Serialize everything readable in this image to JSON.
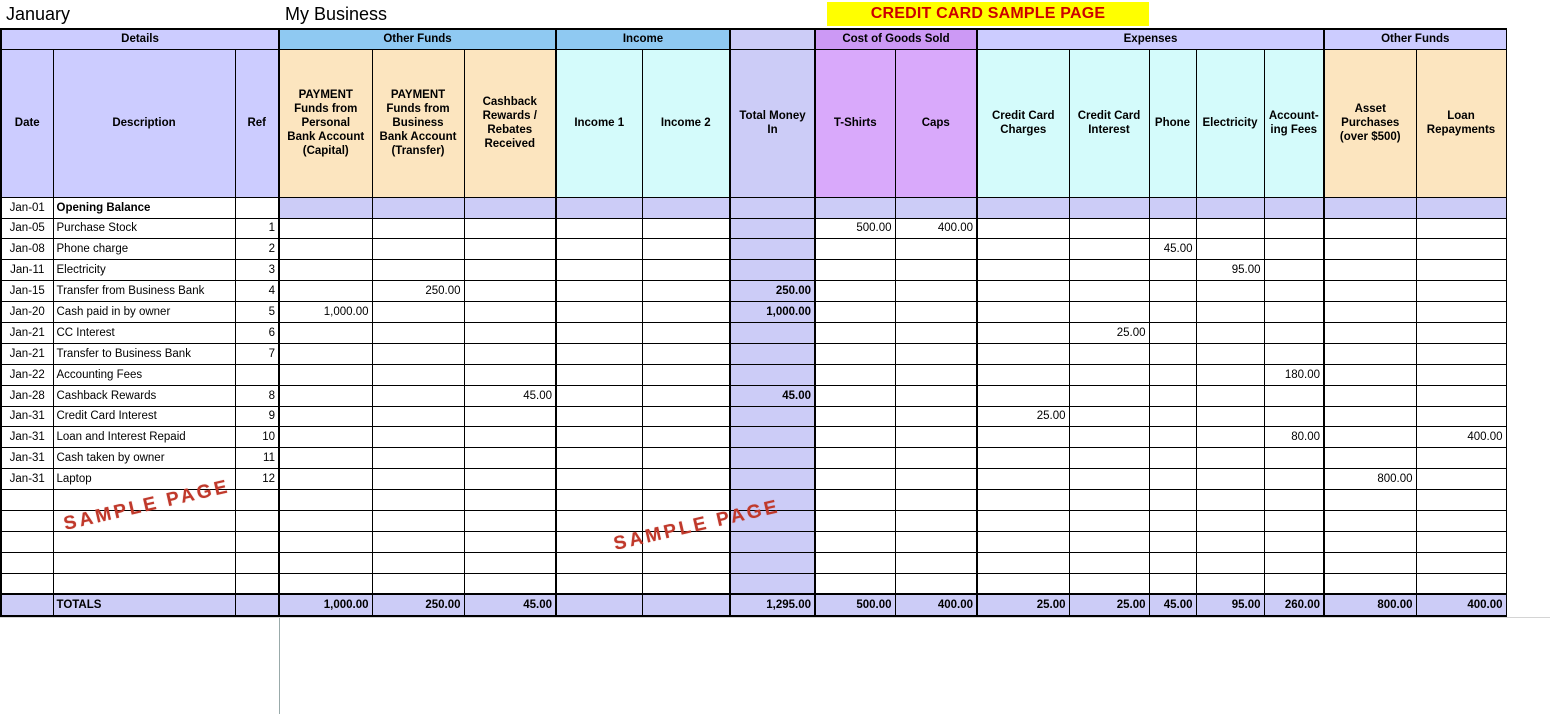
{
  "title": {
    "month": "January",
    "business": "My Business",
    "banner": "CREDIT CARD SAMPLE PAGE"
  },
  "watermark": {
    "text": "SAMPLE PAGE"
  },
  "colors": {
    "details_band": "#CCCCFF",
    "other_funds_band": "#8FC9F2",
    "income_band": "#8FC9F2",
    "cogs_band": "#CC99F5",
    "expenses_band": "#CCCCFF",
    "cream_cell": "#FCE5BF",
    "cyan_cell": "#D4FBFB",
    "lavender_cell": "#CCCCF7",
    "purple_cell": "#D9A9FB",
    "banner_bg": "#FFFF00",
    "banner_text": "#CC0000",
    "watermark_text": "#C0392B"
  },
  "groups": [
    {
      "label": "Details",
      "span": 3
    },
    {
      "label": "Other Funds",
      "span": 3
    },
    {
      "label": "Income",
      "span": 2
    },
    {
      "label": "",
      "span": 1
    },
    {
      "label": "Cost of Goods Sold",
      "span": 2
    },
    {
      "label": "Expenses",
      "span": 5
    },
    {
      "label": "Other Funds",
      "span": 2
    }
  ],
  "columns": [
    {
      "key": "date",
      "label": "Date"
    },
    {
      "key": "description",
      "label": "Description"
    },
    {
      "key": "ref",
      "label": "Ref"
    },
    {
      "key": "pay_personal",
      "label": "PAYMENT\nFunds from\nPersonal\nBank Account\n(Capital)"
    },
    {
      "key": "pay_business",
      "label": "PAYMENT\nFunds from\nBusiness\nBank Account\n(Transfer)"
    },
    {
      "key": "cashback",
      "label": "Cashback\nRewards /\nRebates\nReceived"
    },
    {
      "key": "income1",
      "label": "Income 1"
    },
    {
      "key": "income2",
      "label": "Income 2"
    },
    {
      "key": "total_in",
      "label": "Total Money\nIn"
    },
    {
      "key": "tshirts",
      "label": "T-Shirts"
    },
    {
      "key": "caps",
      "label": "Caps"
    },
    {
      "key": "cc_charges",
      "label": "Credit Card\nCharges"
    },
    {
      "key": "cc_interest",
      "label": "Credit Card\nInterest"
    },
    {
      "key": "phone",
      "label": "Phone"
    },
    {
      "key": "electricity",
      "label": "Electricity"
    },
    {
      "key": "accounting",
      "label": "Account-\ning Fees"
    },
    {
      "key": "assets",
      "label": "Asset\nPurchases\n(over $500)"
    },
    {
      "key": "loan",
      "label": "Loan\nRepayments"
    }
  ],
  "rows": [
    {
      "date": "Jan-01",
      "description": "Opening Balance",
      "ref": "",
      "pay_personal": "",
      "pay_business": "",
      "cashback": "",
      "income1": "",
      "income2": "",
      "total_in": "",
      "tshirts": "",
      "caps": "",
      "cc_charges": "",
      "cc_interest": "",
      "phone": "",
      "electricity": "",
      "accounting": "",
      "assets": "",
      "loan": ""
    },
    {
      "date": "Jan-05",
      "description": "Purchase Stock",
      "ref": "1",
      "pay_personal": "",
      "pay_business": "",
      "cashback": "",
      "income1": "",
      "income2": "",
      "total_in": "",
      "tshirts": "500.00",
      "caps": "400.00",
      "cc_charges": "",
      "cc_interest": "",
      "phone": "",
      "electricity": "",
      "accounting": "",
      "assets": "",
      "loan": ""
    },
    {
      "date": "Jan-08",
      "description": "Phone charge",
      "ref": "2",
      "pay_personal": "",
      "pay_business": "",
      "cashback": "",
      "income1": "",
      "income2": "",
      "total_in": "",
      "tshirts": "",
      "caps": "",
      "cc_charges": "",
      "cc_interest": "",
      "phone": "45.00",
      "electricity": "",
      "accounting": "",
      "assets": "",
      "loan": ""
    },
    {
      "date": "Jan-11",
      "description": "Electricity",
      "ref": "3",
      "pay_personal": "",
      "pay_business": "",
      "cashback": "",
      "income1": "",
      "income2": "",
      "total_in": "",
      "tshirts": "",
      "caps": "",
      "cc_charges": "",
      "cc_interest": "",
      "phone": "",
      "electricity": "95.00",
      "accounting": "",
      "assets": "",
      "loan": ""
    },
    {
      "date": "Jan-15",
      "description": "Transfer from Business Bank",
      "ref": "4",
      "pay_personal": "",
      "pay_business": "250.00",
      "cashback": "",
      "income1": "",
      "income2": "",
      "total_in": "250.00",
      "tshirts": "",
      "caps": "",
      "cc_charges": "",
      "cc_interest": "",
      "phone": "",
      "electricity": "",
      "accounting": "",
      "assets": "",
      "loan": ""
    },
    {
      "date": "Jan-20",
      "description": "Cash paid in by owner",
      "ref": "5",
      "pay_personal": "1,000.00",
      "pay_business": "",
      "cashback": "",
      "income1": "",
      "income2": "",
      "total_in": "1,000.00",
      "tshirts": "",
      "caps": "",
      "cc_charges": "",
      "cc_interest": "",
      "phone": "",
      "electricity": "",
      "accounting": "",
      "assets": "",
      "loan": ""
    },
    {
      "date": "Jan-21",
      "description": "CC Interest",
      "ref": "6",
      "pay_personal": "",
      "pay_business": "",
      "cashback": "",
      "income1": "",
      "income2": "",
      "total_in": "",
      "tshirts": "",
      "caps": "",
      "cc_charges": "",
      "cc_interest": "25.00",
      "phone": "",
      "electricity": "",
      "accounting": "",
      "assets": "",
      "loan": ""
    },
    {
      "date": "Jan-21",
      "description": "Transfer to Business Bank",
      "ref": "7",
      "pay_personal": "",
      "pay_business": "",
      "cashback": "",
      "income1": "",
      "income2": "",
      "total_in": "",
      "tshirts": "",
      "caps": "",
      "cc_charges": "",
      "cc_interest": "",
      "phone": "",
      "electricity": "",
      "accounting": "",
      "assets": "",
      "loan": ""
    },
    {
      "date": "Jan-22",
      "description": "Accounting Fees",
      "ref": "",
      "pay_personal": "",
      "pay_business": "",
      "cashback": "",
      "income1": "",
      "income2": "",
      "total_in": "",
      "tshirts": "",
      "caps": "",
      "cc_charges": "",
      "cc_interest": "",
      "phone": "",
      "electricity": "",
      "accounting": "180.00",
      "assets": "",
      "loan": ""
    },
    {
      "date": "Jan-28",
      "description": "Cashback Rewards",
      "ref": "8",
      "pay_personal": "",
      "pay_business": "",
      "cashback": "45.00",
      "income1": "",
      "income2": "",
      "total_in": "45.00",
      "tshirts": "",
      "caps": "",
      "cc_charges": "",
      "cc_interest": "",
      "phone": "",
      "electricity": "",
      "accounting": "",
      "assets": "",
      "loan": ""
    },
    {
      "date": "Jan-31",
      "description": "Credit Card Interest",
      "ref": "9",
      "pay_personal": "",
      "pay_business": "",
      "cashback": "",
      "income1": "",
      "income2": "",
      "total_in": "",
      "tshirts": "",
      "caps": "",
      "cc_charges": "25.00",
      "cc_interest": "",
      "phone": "",
      "electricity": "",
      "accounting": "",
      "assets": "",
      "loan": ""
    },
    {
      "date": "Jan-31",
      "description": "Loan and Interest Repaid",
      "ref": "10",
      "pay_personal": "",
      "pay_business": "",
      "cashback": "",
      "income1": "",
      "income2": "",
      "total_in": "",
      "tshirts": "",
      "caps": "",
      "cc_charges": "",
      "cc_interest": "",
      "phone": "",
      "electricity": "",
      "accounting": "80.00",
      "assets": "",
      "loan": "400.00"
    },
    {
      "date": "Jan-31",
      "description": "Cash taken by owner",
      "ref": "11",
      "pay_personal": "",
      "pay_business": "",
      "cashback": "",
      "income1": "",
      "income2": "",
      "total_in": "",
      "tshirts": "",
      "caps": "",
      "cc_charges": "",
      "cc_interest": "",
      "phone": "",
      "electricity": "",
      "accounting": "",
      "assets": "",
      "loan": ""
    },
    {
      "date": "Jan-31",
      "description": "Laptop",
      "ref": "12",
      "pay_personal": "",
      "pay_business": "",
      "cashback": "",
      "income1": "",
      "income2": "",
      "total_in": "",
      "tshirts": "",
      "caps": "",
      "cc_charges": "",
      "cc_interest": "",
      "phone": "",
      "electricity": "",
      "accounting": "",
      "assets": "800.00",
      "loan": ""
    },
    {
      "date": "",
      "description": "",
      "ref": "",
      "pay_personal": "",
      "pay_business": "",
      "cashback": "",
      "income1": "",
      "income2": "",
      "total_in": "",
      "tshirts": "",
      "caps": "",
      "cc_charges": "",
      "cc_interest": "",
      "phone": "",
      "electricity": "",
      "accounting": "",
      "assets": "",
      "loan": ""
    },
    {
      "date": "",
      "description": "",
      "ref": "",
      "pay_personal": "",
      "pay_business": "",
      "cashback": "",
      "income1": "",
      "income2": "",
      "total_in": "",
      "tshirts": "",
      "caps": "",
      "cc_charges": "",
      "cc_interest": "",
      "phone": "",
      "electricity": "",
      "accounting": "",
      "assets": "",
      "loan": ""
    },
    {
      "date": "",
      "description": "",
      "ref": "",
      "pay_personal": "",
      "pay_business": "",
      "cashback": "",
      "income1": "",
      "income2": "",
      "total_in": "",
      "tshirts": "",
      "caps": "",
      "cc_charges": "",
      "cc_interest": "",
      "phone": "",
      "electricity": "",
      "accounting": "",
      "assets": "",
      "loan": ""
    },
    {
      "date": "",
      "description": "",
      "ref": "",
      "pay_personal": "",
      "pay_business": "",
      "cashback": "",
      "income1": "",
      "income2": "",
      "total_in": "",
      "tshirts": "",
      "caps": "",
      "cc_charges": "",
      "cc_interest": "",
      "phone": "",
      "electricity": "",
      "accounting": "",
      "assets": "",
      "loan": ""
    },
    {
      "date": "",
      "description": "",
      "ref": "",
      "pay_personal": "",
      "pay_business": "",
      "cashback": "",
      "income1": "",
      "income2": "",
      "total_in": "",
      "tshirts": "",
      "caps": "",
      "cc_charges": "",
      "cc_interest": "",
      "phone": "",
      "electricity": "",
      "accounting": "",
      "assets": "",
      "loan": ""
    }
  ],
  "totals": {
    "label": "TOTALS",
    "date": "",
    "ref": "",
    "pay_personal": "1,000.00",
    "pay_business": "250.00",
    "cashback": "45.00",
    "income1": "",
    "income2": "",
    "total_in": "1,295.00",
    "tshirts": "500.00",
    "caps": "400.00",
    "cc_charges": "25.00",
    "cc_interest": "25.00",
    "phone": "45.00",
    "electricity": "95.00",
    "accounting": "260.00",
    "assets": "800.00",
    "loan": "400.00"
  }
}
